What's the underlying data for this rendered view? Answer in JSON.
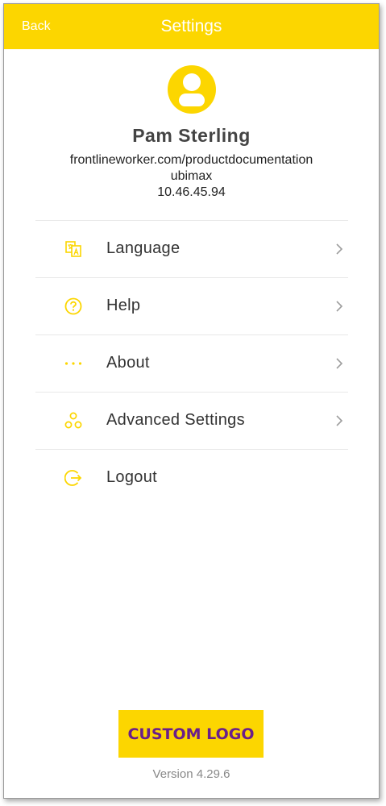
{
  "app_bar": {
    "back_label": "Back",
    "title": "Settings",
    "color": "#FCD600"
  },
  "profile": {
    "name": "Pam Sterling",
    "domain": "frontlineworker.com/productdocumentation",
    "organization": "ubimax",
    "ip_address": "10.46.45.94"
  },
  "menu": {
    "items": [
      {
        "label": "Language",
        "icon": "translate-icon",
        "has_chevron": true
      },
      {
        "label": "Help",
        "icon": "help-circle-icon",
        "has_chevron": true
      },
      {
        "label": "About",
        "icon": "more-dots-icon",
        "has_chevron": true
      },
      {
        "label": "Advanced Settings",
        "icon": "advanced-settings-icon",
        "has_chevron": true
      },
      {
        "label": "Logout",
        "icon": "logout-icon",
        "has_chevron": false
      }
    ]
  },
  "footer": {
    "logo_text": "CUSTOM LOGO",
    "version": "Version 4.29.6"
  },
  "colors": {
    "accent": "#FCD600",
    "logo_text": "#6a1f8a"
  }
}
